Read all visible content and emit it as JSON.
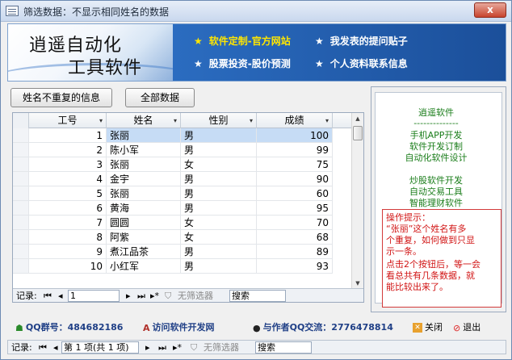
{
  "window": {
    "title": "筛选数据：不显示相同姓名的数据",
    "close_glyph": "x"
  },
  "banner": {
    "brand_line1": "逍遥自动化",
    "brand_line2": "工具软件",
    "links": [
      {
        "star": "★",
        "label": "软件定制-官方网站"
      },
      {
        "star": "★",
        "label": "我发表的提问贴子"
      },
      {
        "star": "★",
        "label": "股票投资-股价预测"
      },
      {
        "star": "★",
        "label": "个人资料联系信息"
      }
    ]
  },
  "buttons": {
    "unique_names": "姓名不重复的信息",
    "all_data": "全部数据"
  },
  "table": {
    "columns": [
      {
        "label": "工号",
        "arrow": "▾"
      },
      {
        "label": "姓名",
        "arrow": "▾"
      },
      {
        "label": "性别",
        "arrow": "▾"
      },
      {
        "label": "成绩",
        "arrow": "▾"
      }
    ],
    "rows": [
      {
        "id": "1",
        "name": "张丽",
        "gender": "男",
        "score": "100"
      },
      {
        "id": "2",
        "name": "陈小军",
        "gender": "男",
        "score": "99"
      },
      {
        "id": "3",
        "name": "张丽",
        "gender": "女",
        "score": "75"
      },
      {
        "id": "4",
        "name": "金宇",
        "gender": "男",
        "score": "90"
      },
      {
        "id": "5",
        "name": "张丽",
        "gender": "男",
        "score": "60"
      },
      {
        "id": "6",
        "name": "黄海",
        "gender": "男",
        "score": "95"
      },
      {
        "id": "7",
        "name": "圆圆",
        "gender": "女",
        "score": "70"
      },
      {
        "id": "8",
        "name": "阿紫",
        "gender": "女",
        "score": "68"
      },
      {
        "id": "9",
        "name": "煮江品茶",
        "gender": "男",
        "score": "89"
      },
      {
        "id": "10",
        "name": "小红军",
        "gender": "男",
        "score": "93"
      }
    ],
    "selected_row": 0,
    "nav": {
      "label": "记录:",
      "first": "⏮",
      "prev": "◂",
      "current": "1",
      "next": "▸",
      "last": "⏭",
      "new": "▸*",
      "filter": "无筛选器",
      "search": "搜索"
    }
  },
  "side_panel": {
    "lines_green": [
      "逍遥软件",
      "--------------",
      "手机APP开发",
      "软件开发订制",
      "自动化软件设计",
      "炒股软件开发",
      "自动交易工具",
      "智能理财软件"
    ],
    "tip_lines": [
      "操作提示：",
      "“张丽”这个姓名有多",
      "个重复，如何做到只显",
      "示一条。",
      "点击2个按钮后，等一会",
      "看总共有几条数据，就",
      "能比较出来了。"
    ]
  },
  "footer": {
    "qq_group": "QQ群号：484682186",
    "visit_site": "访问软件开发网",
    "author_qq": "与作者QQ交流：2776478814",
    "close": "关闭",
    "exit": "退出"
  },
  "bottom_nav": {
    "label": "记录:",
    "first": "⏮",
    "prev": "◂",
    "page": "第 1 项(共 1 项)",
    "next": "▸",
    "last": "⏭",
    "new": "▸*",
    "filter": "无筛选器",
    "search": "搜索"
  },
  "colors": {
    "accent": "#1b4f9a",
    "link_yellow": "#ffe600",
    "green_text": "#1a7d1a",
    "tip_red": "#d11414",
    "selected_row": "#c6dcf5"
  }
}
